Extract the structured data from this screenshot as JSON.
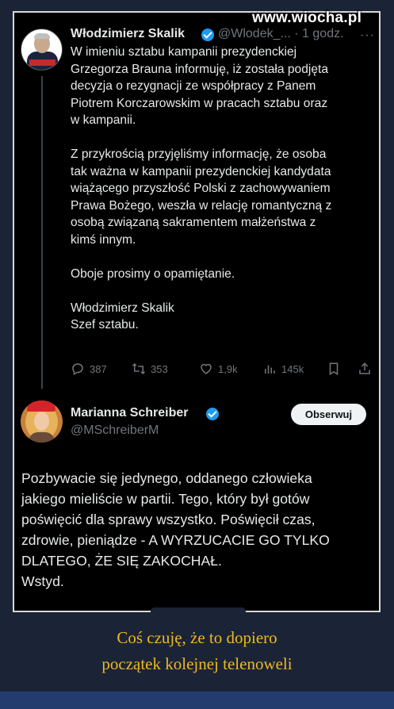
{
  "watermark": "www.wiocha.pl",
  "tweet": {
    "author_name": "Włodzimierz Skalik",
    "handle_time": "@Wlodek_... · 1 godz.",
    "more": "···",
    "text": "W imieniu sztabu kampanii prezydenckiej\nGrzegorza Brauna informuję, iż została podjęta\ndecyzja o rezygnacji ze współpracy z Panem\nPiotrem Korczarowskim w pracach sztabu oraz\nw kampanii.\n\nZ przykrością przyjęliśmy informację, że osoba\ntak ważna w kampanii prezydenckiej kandydata\nwiążącego przyszłość Polski z zachowywaniem\nPrawa Bożego, weszła w relację romantyczną z\nosobą związaną sakramentem małżeństwa z\nkimś innym.\n\nOboje prosimy o opamiętanie.\n\nWłodzimierz Skalik\nSzef sztabu.",
    "stats": {
      "replies": "387",
      "retweets": "353",
      "likes": "1,9k",
      "views": "145k"
    }
  },
  "reply": {
    "author_name": "Marianna Schreiber",
    "handle": "@MSchreiberM",
    "follow_label": "Obserwuj",
    "text": "Pozbywacie się jedynego, oddanego człowieka\njakiego mieliście w partii. Tego, który był gotów\npoświęcić dla sprawy wszystko. Poświęcił czas,\nzdrowie, pieniądze - A WYRZUCACIE GO TYLKO\nDLATEGO, ŻE SIĘ ZAKOCHAŁ.\nWstyd."
  },
  "caption": {
    "line1": "Coś czuję, że to dopiero",
    "line2": "początek kolejnej telenoweli"
  }
}
